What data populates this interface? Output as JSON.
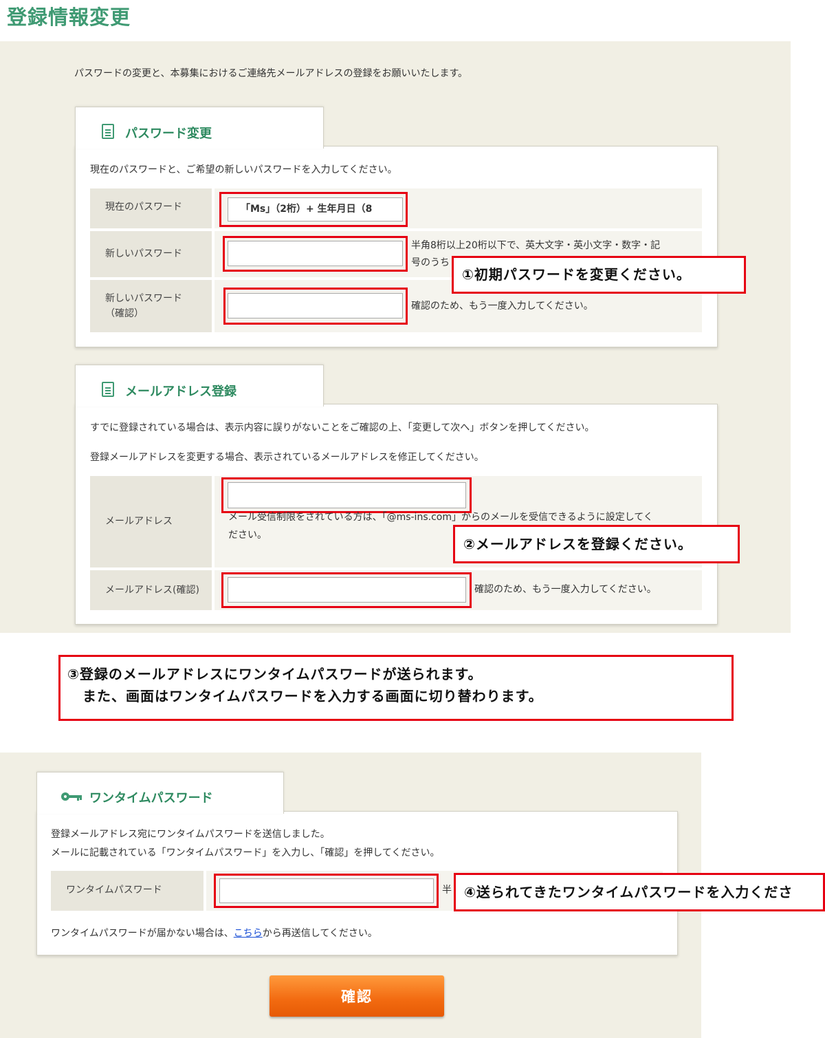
{
  "page_title": "登録情報変更",
  "intro": "パスワードの変更と、本募集におけるご連絡先メールアドレスの登録をお願いいたします。",
  "password_section": {
    "title": "パスワード変更",
    "description": "現在のパスワードと、ご希望の新しいパスワードを入力してください。",
    "current_label": "現在のパスワード",
    "current_value": "「Ms」（2桁）+ 生年月日（8",
    "new_label": "新しいパスワード",
    "new_note_line1": "半角8桁以上20桁以下で、英大文字・英小文字・数字・記",
    "new_note_line2": "号のうち",
    "confirm_label_line1": "新しいパスワード",
    "confirm_label_line2": "（確認）",
    "confirm_note": "確認のため、もう一度入力してください。"
  },
  "email_section": {
    "title": "メールアドレス登録",
    "description1": "すでに登録されている場合は、表示内容に誤りがないことをご確認の上、「変更して次へ」ボタンを押してください。",
    "description2": "登録メールアドレスを変更する場合、表示されているメールアドレスを修正してください。",
    "email_label": "メールアドレス",
    "email_note_line1": "メール受信制限をされている方は、「@ms-ins.com」からのメールを受信できるように設定してく",
    "email_note_line2": "ださい。",
    "email_confirm_label": "メールアドレス(確認)",
    "email_confirm_note": "確認のため、もう一度入力してください。"
  },
  "otp_section": {
    "title": "ワンタイムパスワード",
    "description1": "登録メールアドレス宛にワンタイムパスワードを送信しました。",
    "description2": "メールに記載されている「ワンタイムパスワード」を入力し、「確認」を押してください。",
    "otp_label": "ワンタイムパスワード",
    "otp_note_fragment": "半",
    "resend_prefix": "ワンタイムパスワードが届かない場合は、",
    "resend_link": "こちら",
    "resend_suffix": "から再送信してください。"
  },
  "confirm_button": "確認",
  "callouts": {
    "c1": "①初期パスワードを変更ください。",
    "c2": "②メールアドレスを登録ください。",
    "c3_line1": "③登録のメールアドレスにワンタイムパスワードが送られます。",
    "c3_line2": "また、画面はワンタイムパスワードを入力する画面に切り替わります。",
    "c4": "④送られてきたワンタイムパスワードを入力くださ"
  },
  "colors": {
    "accent_green": "#3f9a73",
    "annotation_red": "#e60012",
    "button_orange": "#f26a10",
    "page_bg": "#f1efe4"
  },
  "icons": {
    "section_icon": "document-icon",
    "otp_icon": "key-icon"
  }
}
